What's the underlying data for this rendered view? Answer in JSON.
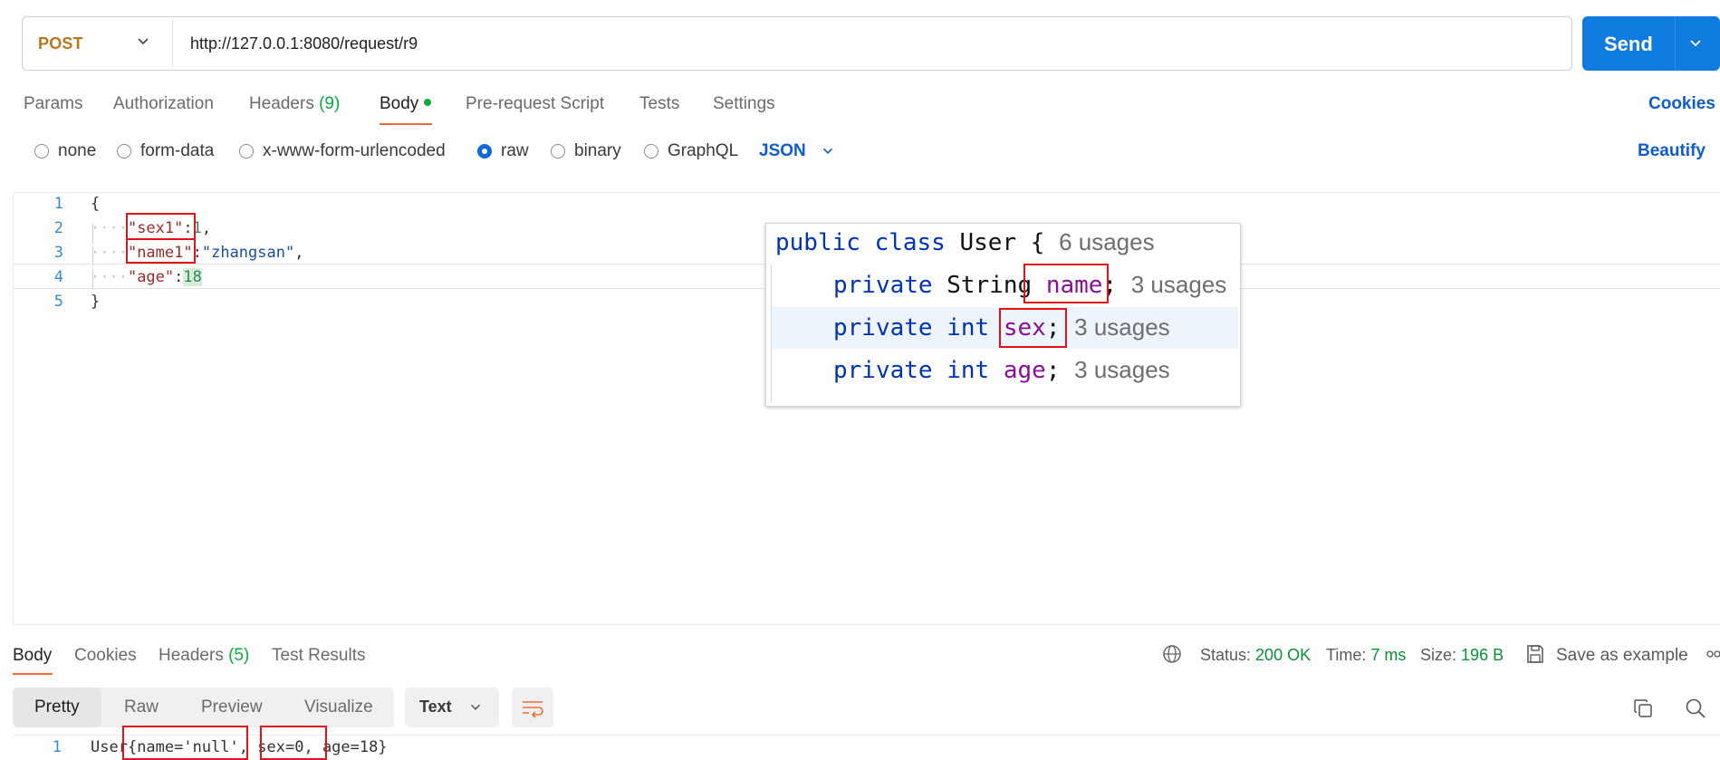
{
  "request": {
    "method": "POST",
    "url": "http://127.0.0.1:8080/request/r9",
    "send_label": "Send"
  },
  "tabs": {
    "params": "Params",
    "authorization": "Authorization",
    "headers": "Headers",
    "headers_count": "(9)",
    "body": "Body",
    "pre_request": "Pre-request Script",
    "tests": "Tests",
    "settings": "Settings",
    "cookies": "Cookies"
  },
  "body_types": {
    "none": "none",
    "form_data": "form-data",
    "urlencoded": "x-www-form-urlencoded",
    "raw": "raw",
    "binary": "binary",
    "graphql": "GraphQL",
    "format": "JSON",
    "beautify": "Beautify",
    "selected": "raw"
  },
  "editor": {
    "line_numbers": [
      "1",
      "2",
      "3",
      "4",
      "5"
    ],
    "open_brace": "{",
    "close_brace": "}",
    "indent": "····",
    "key1": "\"sex1\"",
    "val1": "1",
    "key2": "\"name1\"",
    "val2": "\"zhangsan\"",
    "key3": "\"age\"",
    "val3": "18",
    "colon": ":",
    "comma": ","
  },
  "popup": {
    "class_kw": "public class",
    "class_name": "User {",
    "class_usages": "6 usages",
    "private": "private",
    "type_string": "String",
    "type_int": "int",
    "field_name": "name",
    "field_sex": "sex",
    "field_age": "age",
    "semicolon": ";",
    "field_usages": "3 usages"
  },
  "response": {
    "tabs": {
      "body": "Body",
      "cookies": "Cookies",
      "headers": "Headers",
      "headers_count": "(5)",
      "test_results": "Test Results"
    },
    "status_label": "Status:",
    "status_value": "200 OK",
    "time_label": "Time:",
    "time_value": "7 ms",
    "size_label": "Size:",
    "size_value": "196 B",
    "save_example": "Save as example",
    "views": {
      "pretty": "Pretty",
      "raw": "Raw",
      "preview": "Preview",
      "visualize": "Visualize"
    },
    "text_format": "Text",
    "line_number": "1",
    "output_prefix": "User{",
    "output_name": "name='null',",
    "output_sex": "sex=0,",
    "output_age": "age=18}"
  },
  "colors": {
    "accent_blue": "#0f7bdf",
    "tab_underline": "#f26b3a",
    "status_green": "#0c8f3a",
    "method_orange": "#b7791f",
    "annotation_red": "#e0131b"
  }
}
